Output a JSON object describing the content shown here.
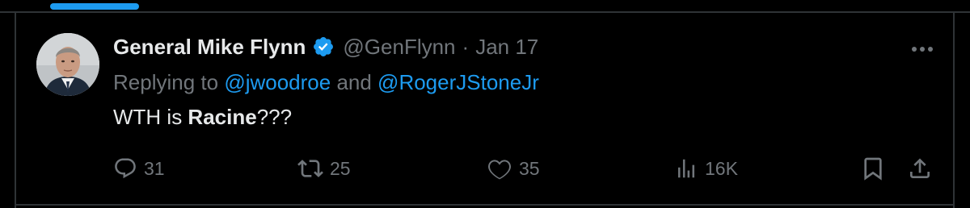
{
  "tweet": {
    "author_name": "General Mike Flynn",
    "handle": "@GenFlynn",
    "separator": "·",
    "timestamp": "Jan 17",
    "replying_prefix": "Replying to ",
    "reply_mention_1": "@jwoodroe",
    "reply_conjunction": " and ",
    "reply_mention_2": "@RogerJStoneJr",
    "text_before": "WTH is ",
    "text_bold": "Racine",
    "text_after": "???"
  },
  "actions": {
    "replies": "31",
    "reposts": "25",
    "likes": "35",
    "views": "16K"
  },
  "icons": {
    "verified": "verified-badge-icon",
    "more": "more-dots-icon",
    "reply": "reply-bubble-icon",
    "repost": "repost-arrows-icon",
    "like": "heart-icon",
    "views": "bar-chart-icon",
    "bookmark": "bookmark-icon",
    "share": "share-upload-icon"
  },
  "colors": {
    "background": "#000000",
    "primary_text": "#e7e9ea",
    "secondary_text": "#71767b",
    "accent": "#1d9bf0",
    "border": "#2f3336"
  }
}
